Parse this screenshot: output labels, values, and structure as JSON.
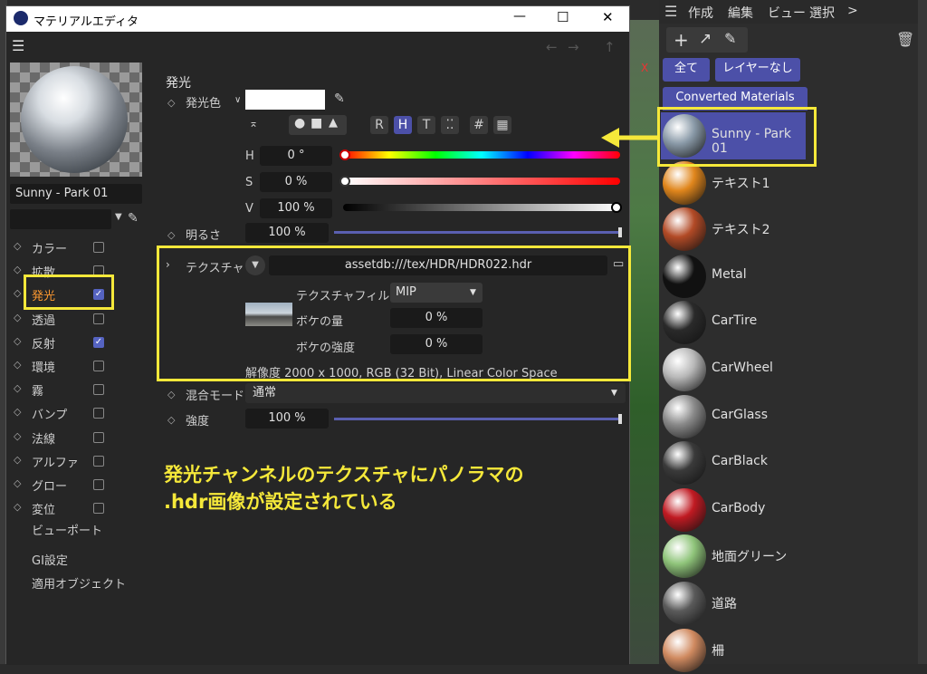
{
  "window": {
    "title": "マテリアルエディタ",
    "minimize": "—",
    "maximize": "☐",
    "close": "✕"
  },
  "top_menu": {
    "items": [
      "作成",
      "編集",
      "ビュー",
      "選択",
      ">"
    ]
  },
  "preview": {
    "material_name": "Sunny - Park 01"
  },
  "channels": [
    {
      "label": "カラー",
      "checked": false
    },
    {
      "label": "拡散",
      "checked": false
    },
    {
      "label": "発光",
      "checked": true
    },
    {
      "label": "透過",
      "checked": false
    },
    {
      "label": "反射",
      "checked": true
    },
    {
      "label": "環境",
      "checked": false
    },
    {
      "label": "霧",
      "checked": false
    },
    {
      "label": "バンプ",
      "checked": false
    },
    {
      "label": "法線",
      "checked": false
    },
    {
      "label": "アルファ",
      "checked": false
    },
    {
      "label": "グロー",
      "checked": false
    },
    {
      "label": "変位",
      "checked": false
    }
  ],
  "extra_items": [
    "ビューポート",
    "GI設定",
    "適用オブジェクト"
  ],
  "emission": {
    "section_title": "発光",
    "color_label": "発光色",
    "mode_buttons": [
      "R",
      "H",
      "T",
      "#"
    ],
    "h_label": "H",
    "h_value": "0 °",
    "s_label": "S",
    "s_value": "0 %",
    "v_label": "V",
    "v_value": "100 %",
    "brightness_label": "明るさ",
    "brightness_value": "100 %",
    "texture_label": "テクスチャ",
    "texture_path": "assetdb:///tex/HDR/HDR022.hdr",
    "filter_label": "テクスチャフィルタ",
    "filter_value": "MIP",
    "blur_amount_label": "ボケの量",
    "blur_amount_value": "0 %",
    "blur_strength_label": "ボケの強度",
    "blur_strength_value": "0 %",
    "resolution": "解像度 2000 x 1000, RGB (32 Bit), Linear Color Space",
    "blend_label": "混合モード",
    "blend_value": "通常",
    "strength_label": "強度",
    "strength_value": "100 %"
  },
  "annotation": {
    "line1": "発光チャンネルのテクスチャにパノラマの",
    "line2": ".hdr画像が設定されている"
  },
  "material_manager": {
    "all_label": "全て",
    "no_layer_label": "レイヤーなし",
    "group_label": "Converted Materials",
    "materials": [
      {
        "name": "Sunny - Park 01",
        "color": "#8a9aa8"
      },
      {
        "name": "テキスト1",
        "color": "#e0861c"
      },
      {
        "name": "テキスト2",
        "color": "#b24a26"
      },
      {
        "name": "Metal",
        "color": "#111111"
      },
      {
        "name": "CarTire",
        "color": "#2a2a2a"
      },
      {
        "name": "CarWheel",
        "color": "#b8b8b8"
      },
      {
        "name": "CarGlass",
        "color": "#8a8a8a"
      },
      {
        "name": "CarBlack",
        "color": "#3a3a3a"
      },
      {
        "name": "CarBody",
        "color": "#c01a22"
      },
      {
        "name": "地面グリーン",
        "color": "#8fc47a"
      },
      {
        "name": "道路",
        "color": "#5a5a5a"
      },
      {
        "name": "柵",
        "color": "#d08a60"
      }
    ]
  },
  "colors": {
    "accent": "#4c50a8",
    "highlight": "#f5e83a",
    "panel": "#262626"
  }
}
